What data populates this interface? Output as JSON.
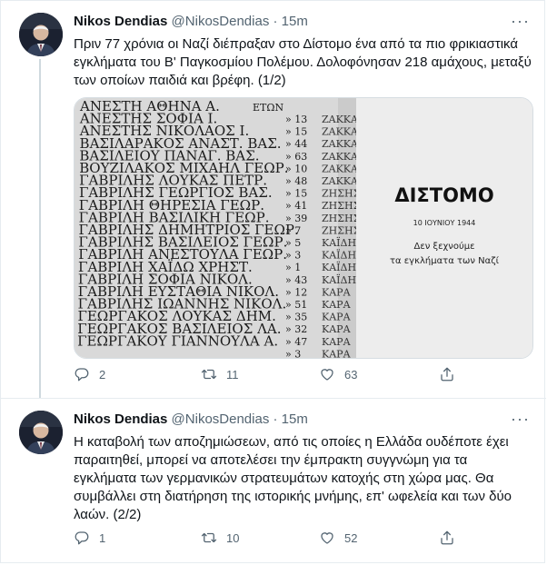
{
  "tweets": [
    {
      "name": "Nikos Dendias",
      "handle": "@NikosDendias",
      "dot": "·",
      "time": "15m",
      "text": "Πριν 77 χρόνια οι Ναζί διέπραξαν στο Δίστομο ένα από τα πιο φρικιαστικά εγκλήματα του Β' Παγκοσμίου Πολέμου. Δολοφόνησαν 218 αμάχους, μεταξύ των οποίων παιδιά και βρέφη. (1/2)",
      "media": {
        "memorial_names": [
          "ΑΝΕΣΤΗ ΑΘΗΝΑ Α.",
          "ΑΝΕΣΤΗΣ ΣΟΦΙΑ Ι.",
          "ΑΝΕΣΤΗΣ ΝΙΚΟΛΑΟΣ Ι.",
          "ΒΑΣΙΛΑΡΑΚΟΣ ΑΝΑΣΤ. ΒΑΣ.",
          "ΒΑΣΙΛΕΙΟΥ ΠΑΝΑΓ. ΒΑΣ.",
          "ΒΟΥΖΙΛΑΚΟΣ ΜΙΧΑΗΛ ΓΕΩΡ.",
          "ΓΑΒΡΙΛΗΣ ΛΟΥΚΑΣ ΠΕΤΡ.",
          "ΓΑΒΡΙΛΗΣ ΓΕΩΡΓΙΟΣ ΒΑΣ.",
          "ΓΑΒΡΙΛΗ ΘΗΡΕΣΙΑ ΓΕΩΡ.",
          "ΓΑΒΡΙΛΗ ΒΑΣΙΛΙΚΗ ΓΕΩΡ.",
          "ΓΑΒΡΙΛΗΣ ΔΗΜΗΤΡΙΟΣ ΓΕΩΡ.",
          "ΓΑΒΡΙΛΗΣ ΒΑΣΙΛΕΙΟΣ ΓΕΩΡ.",
          "ΓΑΒΡΙΛΗ ΑΝΕΣΤΟΥΛΑ ΓΕΩΡ.",
          "ΓΑΒΡΙΛΗ ΧΑΪΔΩ ΧΡΗΣΤ.",
          "ΓΑΒΡΙΛΗ ΣΟΦΙΑ ΝΙΚΟΛ.",
          "ΓΑΒΡΙΛΗ ΕΥΣΤΑΘΙΑ ΝΙΚΟΛ.",
          "ΓΑΒΡΙΛΗΣ ΙΩΑΝΝΗΣ ΝΙΚΟΛ.",
          "ΓΕΩΡΓΑΚΟΣ ΛΟΥΚΑΣ ΔΗΜ.",
          "ΓΕΩΡΓΑΚΟΣ ΒΑΣΙΛΕΙΟΣ ΛΑ.",
          "ΓΕΩΡΓΑΚΟΥ ΓΙΑΝΝΟΥΛΑ Α."
        ],
        "etwn_header": "ΕΤΩΝ",
        "ages": [
          "13",
          "15",
          "44",
          "63",
          "10",
          "48",
          "15",
          "41",
          "39",
          "7",
          "5",
          "3",
          "1",
          "43",
          "12",
          "51",
          "35",
          "32",
          "47",
          "3"
        ],
        "right_names": [
          "ΖΑΚΚΑ",
          "ΖΑΚΚΑ",
          "ΖΑΚΚΑ",
          "ΖΑΚΚΑ",
          "ΖΑΚΚΑ",
          "ΖΑΚΚΑ",
          "ΖΗΣΗΣ",
          "ΖΗΣΗΣ",
          "ΖΗΣΗΣ",
          "ΖΗΣΗΣ",
          "ΚΑΪΔΗ",
          "ΚΑΪΔΗ",
          "ΚΑΪΔΗ",
          "ΚΑΪΔΗ",
          "ΚΑΡΑ",
          "ΚΑΡΑ",
          "ΚΑΡΑ",
          "ΚΑΡΑ",
          "ΚΑΡΑ",
          "ΚΑΡΑ"
        ],
        "title": "ΔΙΣΤΟΜΟ",
        "date": "10 ΙΟΥΝΙΟΥ 1944",
        "slogan_line1": "Δεν ξεχνούμε",
        "slogan_line2": "τα εγκλήματα των Ναζί"
      },
      "actions": {
        "reply": "2",
        "retweet": "11",
        "like": "63"
      }
    },
    {
      "name": "Nikos Dendias",
      "handle": "@NikosDendias",
      "dot": "·",
      "time": "15m",
      "text": "Η καταβολή των αποζημιώσεων, από τις οποίες η Ελλάδα ουδέποτε έχει παραιτηθεί, μπορεί να αποτελέσει την έμπρακτη συγγνώμη για τα εγκλήματα των γερμανικών στρατευμάτων κατοχής στη χώρα μας. Θα συμβάλλει στη διατήρηση της ιστορικής μνήμης, επ' ωφελεία και των δύο λαών. (2/2)",
      "actions": {
        "reply": "1",
        "retweet": "10",
        "like": "52"
      }
    }
  ],
  "colors": {
    "text": "#0f1419",
    "muted": "#536471",
    "border": "#e6ecf0",
    "media_bg": "#ececec"
  },
  "icons": [
    "more-icon",
    "reply-icon",
    "retweet-icon",
    "like-icon",
    "share-icon"
  ]
}
